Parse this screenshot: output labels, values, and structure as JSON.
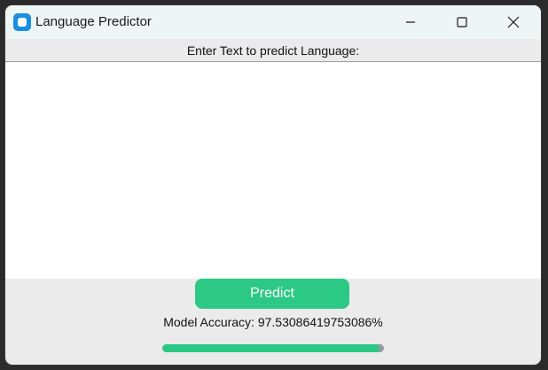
{
  "window": {
    "title": "Language Predictor",
    "app_icon": "app-icon",
    "controls": [
      "minimize-icon",
      "maximize-icon",
      "close-icon"
    ]
  },
  "prompt": {
    "label": "Enter Text to predict Language:"
  },
  "text_input": {
    "value": "",
    "placeholder": ""
  },
  "predict_button": {
    "label": "Predict"
  },
  "model": {
    "accuracy_text": "Model Accuracy: 97.53086419753086%",
    "progress_fraction": 0.98
  },
  "colors": {
    "accent": "#2cc985",
    "progress_track": "#939ba2",
    "background": "#ebebeb",
    "titlebar": "#eef5f5",
    "app_icon": "#1a8fe0"
  }
}
